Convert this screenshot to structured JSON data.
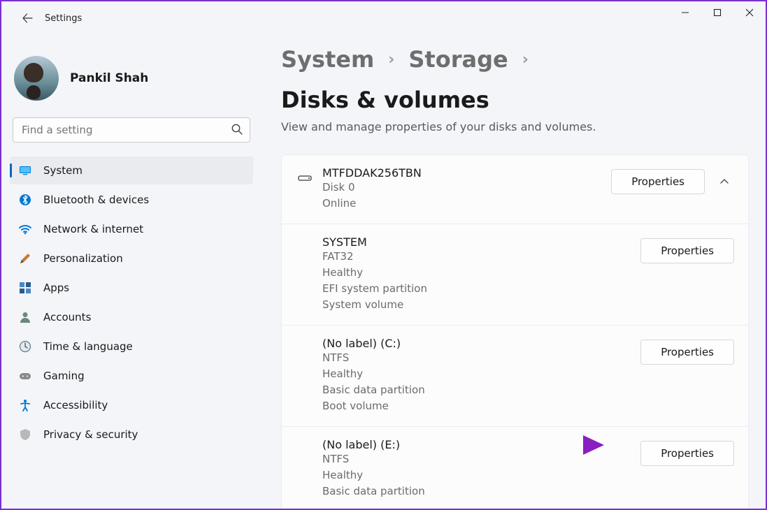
{
  "window": {
    "title": "Settings"
  },
  "user": {
    "name": "Pankil Shah"
  },
  "search": {
    "placeholder": "Find a setting"
  },
  "nav": {
    "items": [
      {
        "id": "system",
        "label": "System",
        "active": true
      },
      {
        "id": "bluetooth",
        "label": "Bluetooth & devices"
      },
      {
        "id": "network",
        "label": "Network & internet"
      },
      {
        "id": "personalization",
        "label": "Personalization"
      },
      {
        "id": "apps",
        "label": "Apps"
      },
      {
        "id": "accounts",
        "label": "Accounts"
      },
      {
        "id": "time",
        "label": "Time & language"
      },
      {
        "id": "gaming",
        "label": "Gaming"
      },
      {
        "id": "accessibility",
        "label": "Accessibility"
      },
      {
        "id": "privacy",
        "label": "Privacy & security"
      }
    ]
  },
  "breadcrumb": {
    "a": "System",
    "b": "Storage",
    "current": "Disks & volumes"
  },
  "subtitle": "View and manage properties of your disks and volumes.",
  "buttons": {
    "properties": "Properties"
  },
  "disks": [
    {
      "title": "MTFDDAK256TBN",
      "lines": [
        "Disk 0",
        "Online"
      ],
      "has_icon": true,
      "has_chevron": true,
      "volumes": [
        {
          "title": "SYSTEM",
          "lines": [
            "FAT32",
            "Healthy",
            "EFI system partition",
            "System volume"
          ]
        },
        {
          "title": "(No label) (C:)",
          "lines": [
            "NTFS",
            "Healthy",
            "Basic data partition",
            "Boot volume"
          ]
        },
        {
          "title": "(No label) (E:)",
          "lines": [
            "NTFS",
            "Healthy",
            "Basic data partition"
          ]
        }
      ]
    }
  ]
}
